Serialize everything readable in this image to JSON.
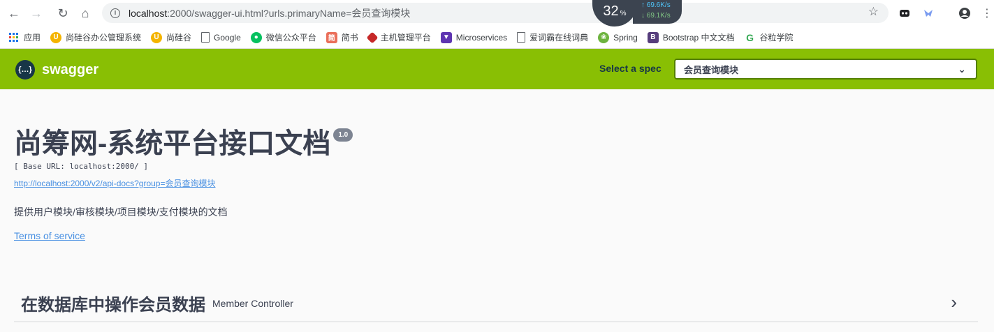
{
  "browser": {
    "url_host": "localhost",
    "url_rest": ":2000/swagger-ui.html?urls.primaryName=会员查询模块",
    "speed": {
      "percent": "32",
      "percent_unit": "%",
      "up": "↑ 69.6K/s",
      "down": "↓ 69.1K/s"
    },
    "bookmarks": [
      {
        "label": "应用",
        "icon": "apps-icon",
        "color": "#1a73e8"
      },
      {
        "label": "尚硅谷办公管理系统",
        "icon": "u-icon",
        "color": "#f4b400"
      },
      {
        "label": "尚硅谷",
        "icon": "u-icon",
        "color": "#f4b400"
      },
      {
        "label": "Google",
        "icon": "page-icon",
        "color": "#5f6368"
      },
      {
        "label": "微信公众平台",
        "icon": "wechat-icon",
        "color": "#07c160"
      },
      {
        "label": "简书",
        "icon": "jianshu-icon",
        "color": "#ea6f5a"
      },
      {
        "label": "主机管理平台",
        "icon": "diamond-icon",
        "color": "#c62828"
      },
      {
        "label": "Microservices",
        "icon": "ms-icon",
        "color": "#5e35b1"
      },
      {
        "label": "爱词霸在线词典",
        "icon": "page-icon",
        "color": "#5f6368"
      },
      {
        "label": "Spring",
        "icon": "spring-icon",
        "color": "#6db33f"
      },
      {
        "label": "Bootstrap 中文文档",
        "icon": "bootstrap-icon",
        "color": "#563d7c"
      },
      {
        "label": "谷粒学院",
        "icon": "g-icon",
        "color": "#34a853"
      }
    ]
  },
  "swagger": {
    "logo_mark": "{…}",
    "logo_text": "swagger",
    "spec_label": "Select a spec",
    "spec_value": "会员查询模块"
  },
  "info": {
    "title": "尚筹网-系统平台接口文档",
    "version": "1.0",
    "base_url": "[ Base URL: localhost:2000/ ]",
    "docs_link": "http://localhost:2000/v2/api-docs?group=会员查询模块",
    "description": "提供用户模块/审核模块/项目模块/支付模块的文档",
    "terms": "Terms of service"
  },
  "tag": {
    "name": "在数据库中操作会员数据",
    "description": "Member Controller"
  }
}
